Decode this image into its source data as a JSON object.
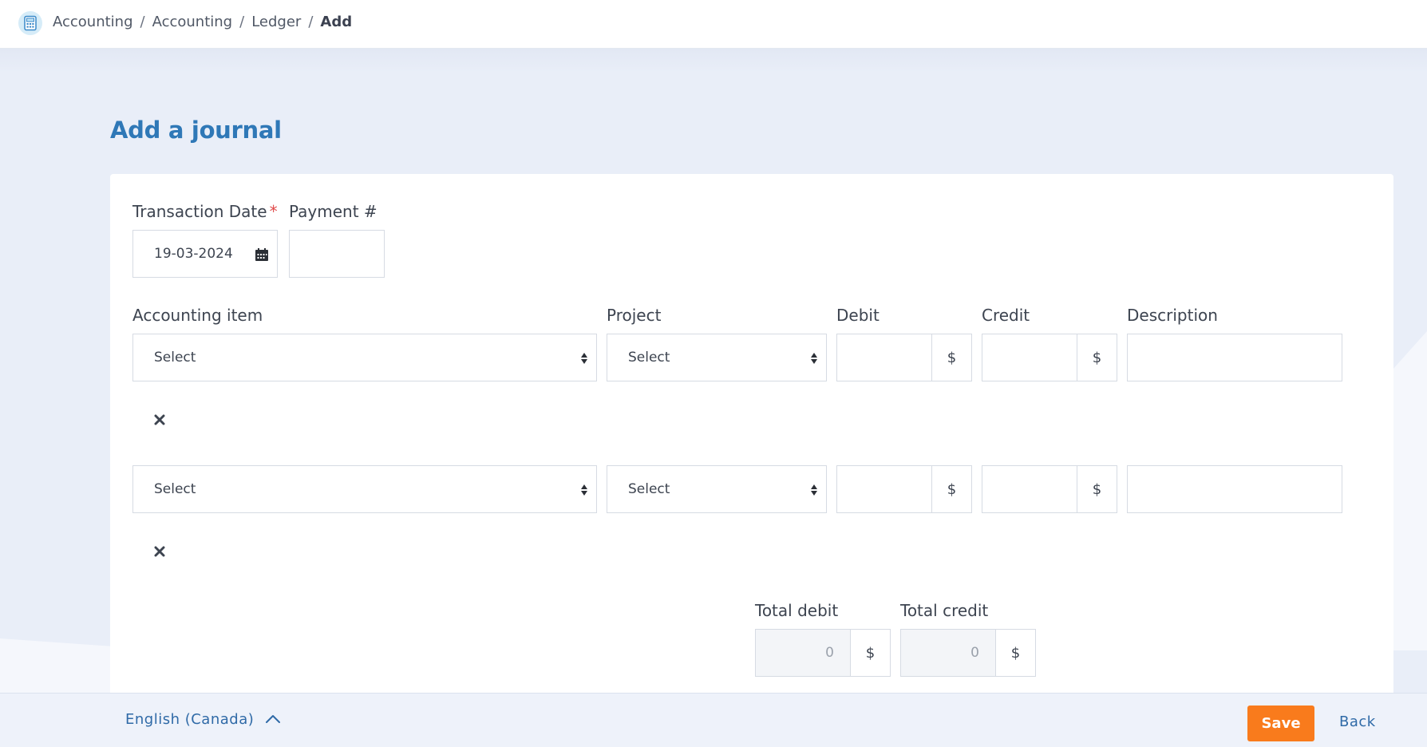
{
  "breadcrumb": {
    "items": [
      "Accounting",
      "Accounting",
      "Ledger"
    ],
    "current": "Add",
    "separator": "/"
  },
  "page": {
    "title": "Add a journal"
  },
  "form": {
    "transaction_date": {
      "label": "Transaction Date",
      "required_mark": "*",
      "value": "19-03-2024"
    },
    "payment_number": {
      "label": "Payment #",
      "value": ""
    },
    "columns": {
      "accounting_item": "Accounting item",
      "project": "Project",
      "debit": "Debit",
      "credit": "Credit",
      "description": "Description"
    },
    "rows": [
      {
        "accounting_item": "Select",
        "project": "Select",
        "debit": "",
        "debit_currency": "$",
        "credit": "",
        "credit_currency": "$",
        "description": ""
      },
      {
        "accounting_item": "Select",
        "project": "Select",
        "debit": "",
        "debit_currency": "$",
        "credit": "",
        "credit_currency": "$",
        "description": ""
      }
    ],
    "totals": {
      "total_debit_label": "Total debit",
      "total_debit_value": "0",
      "total_debit_currency": "$",
      "total_credit_label": "Total credit",
      "total_credit_value": "0",
      "total_credit_currency": "$"
    }
  },
  "footer": {
    "language": "English (Canada)",
    "save_label": "Save",
    "back_label": "Back"
  },
  "colors": {
    "accent": "#2f78b7",
    "save_button": "#f97b1c",
    "page_background": "#e9eef8",
    "required": "#e04a4a"
  },
  "icons": {
    "app": "calculator-icon",
    "date": "calendar-icon",
    "select": "sort-arrows-icon",
    "remove_row": "close-icon",
    "language": "chevron-up-icon"
  }
}
